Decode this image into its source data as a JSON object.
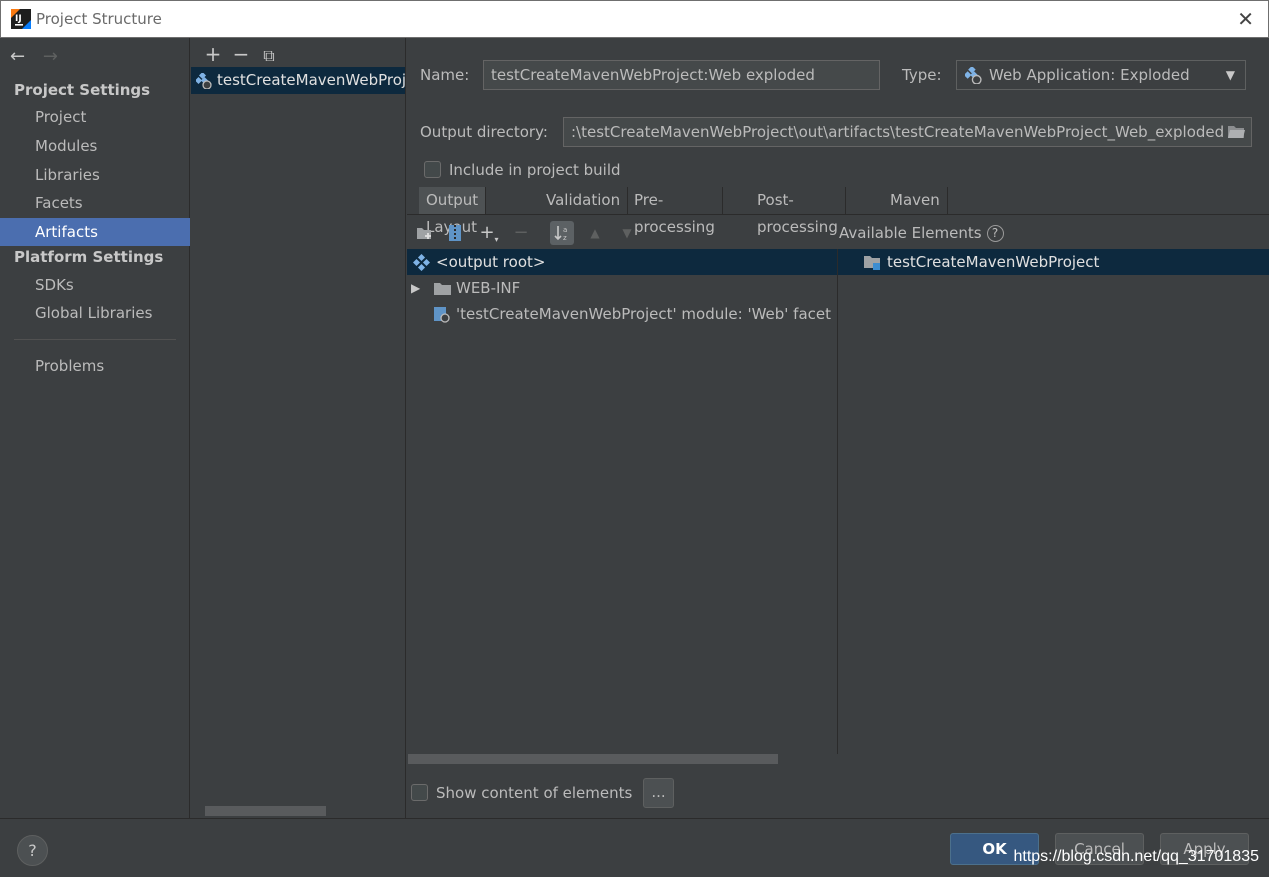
{
  "window": {
    "title": "Project Structure",
    "close_glyph": "✕"
  },
  "nav": {
    "back_glyph": "←",
    "forward_glyph": "→",
    "project_settings": "Project Settings",
    "platform_settings": "Platform Settings",
    "items": {
      "project": "Project",
      "modules": "Modules",
      "libraries": "Libraries",
      "facets": "Facets",
      "artifacts": "Artifacts",
      "sdks": "SDKs",
      "global_libraries": "Global Libraries",
      "problems": "Problems"
    },
    "selected": "Artifacts"
  },
  "artifacts_list": {
    "add_glyph": "+",
    "remove_glyph": "−",
    "copy_glyph": "⧉",
    "items": [
      "testCreateMavenWebProject:Web exploded"
    ]
  },
  "artifact": {
    "name_label": "Name:",
    "name_value": "testCreateMavenWebProject:Web exploded",
    "type_label": "Type:",
    "type_value": "Web Application: Exploded",
    "output_label": "Output directory:",
    "output_value": ":\\testCreateMavenWebProject\\out\\artifacts\\testCreateMavenWebProject_Web_exploded",
    "include_label": "Include in project build",
    "include_checked": false
  },
  "tabs": [
    "Output Layout",
    "Validation",
    "Pre-processing",
    "Post-processing",
    "Maven"
  ],
  "active_tab": "Output Layout",
  "layout_toolbar": {
    "available_elements": "Available Elements",
    "help_glyph": "?"
  },
  "output_tree": [
    {
      "label": "<output root>",
      "selected": true
    },
    {
      "label": "WEB-INF",
      "collapsed": true
    },
    {
      "label": "'testCreateMavenWebProject' module: 'Web' facet resources"
    }
  ],
  "available_tree": [
    {
      "label": "testCreateMavenWebProject",
      "selected": true
    }
  ],
  "show_content_label": "Show content of elements",
  "show_content_checked": false,
  "dots_label": "...",
  "buttons": {
    "help": "?",
    "ok": "OK",
    "cancel": "Cancel",
    "apply": "Apply"
  },
  "watermark": "https://blog.csdn.net/qq_31701835",
  "colors": {
    "background": "#3c3f41",
    "selection": "#4b6eaf",
    "tree_selection": "#0d293e",
    "ok_button": "#365880"
  }
}
